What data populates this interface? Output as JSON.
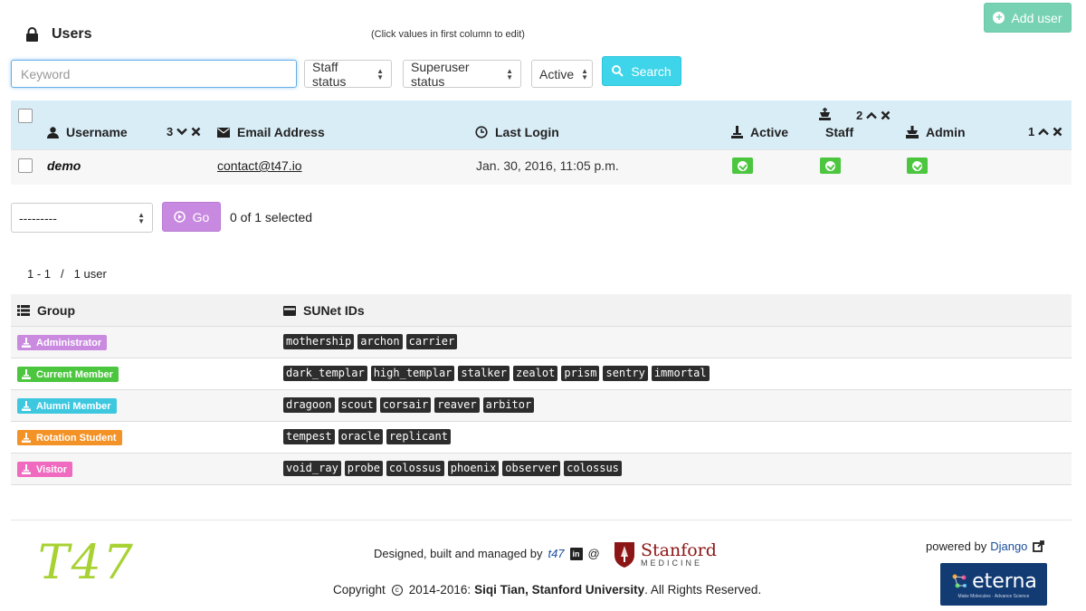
{
  "header": {
    "title": "Users",
    "hint": "(Click values in first column to edit)",
    "add_label": "Add user"
  },
  "filters": {
    "keyword_placeholder": "Keyword",
    "staff_status": "Staff status",
    "superuser_status": "Superuser status",
    "active": "Active",
    "search_label": "Search"
  },
  "table": {
    "columns": {
      "username": "Username",
      "username_sort": "3",
      "email": "Email Address",
      "last_login": "Last Login",
      "active": "Active",
      "staff": "Staff",
      "staff_sort": "2",
      "admin": "Admin",
      "admin_sort": "1"
    },
    "rows": [
      {
        "username": "demo",
        "email": "contact@t47.io",
        "last_login": "Jan. 30, 2016, 11:05 p.m.",
        "active": true,
        "staff": true,
        "admin": true
      }
    ]
  },
  "actions": {
    "select_value": "---------",
    "go_label": "Go",
    "selected_text": "0 of 1 selected"
  },
  "pagination": {
    "range": "1 - 1",
    "separator": "/",
    "total": "1 user"
  },
  "groups": {
    "header_group": "Group",
    "header_ids": "SUNet IDs",
    "rows": [
      {
        "name": "Administrator",
        "color": "#c98ae0",
        "ids": [
          "mothership",
          "archon",
          "carrier"
        ]
      },
      {
        "name": "Current Member",
        "color": "#4cc63f",
        "ids": [
          "dark_templar",
          "high_templar",
          "stalker",
          "zealot",
          "prism",
          "sentry",
          "immortal"
        ]
      },
      {
        "name": "Alumni Member",
        "color": "#3ec8e0",
        "ids": [
          "dragoon",
          "scout",
          "corsair",
          "reaver",
          "arbitor"
        ]
      },
      {
        "name": "Rotation Student",
        "color": "#f39226",
        "ids": [
          "tempest",
          "oracle",
          "replicant"
        ]
      },
      {
        "name": "Visitor",
        "color": "#f06bc0",
        "ids": [
          "void_ray",
          "probe",
          "colossus",
          "phoenix",
          "observer",
          "colossus"
        ]
      }
    ]
  },
  "footer": {
    "logo_text": "T47",
    "designed_text": "Designed, built and managed by",
    "designed_link": "t47",
    "at": "@",
    "stanford_name": "Stanford",
    "stanford_sub": "MEDICINE",
    "copyright_prefix": "Copyright",
    "copyright_years": "2014-2016:",
    "copyright_owner": "Siqi Tian, Stanford University",
    "copyright_suffix": ". All Rights Reserved.",
    "powered_text": "powered by",
    "powered_link": "Django",
    "eterna_name": "eterna",
    "eterna_tagline": "Make Molecules · Advance Science"
  }
}
